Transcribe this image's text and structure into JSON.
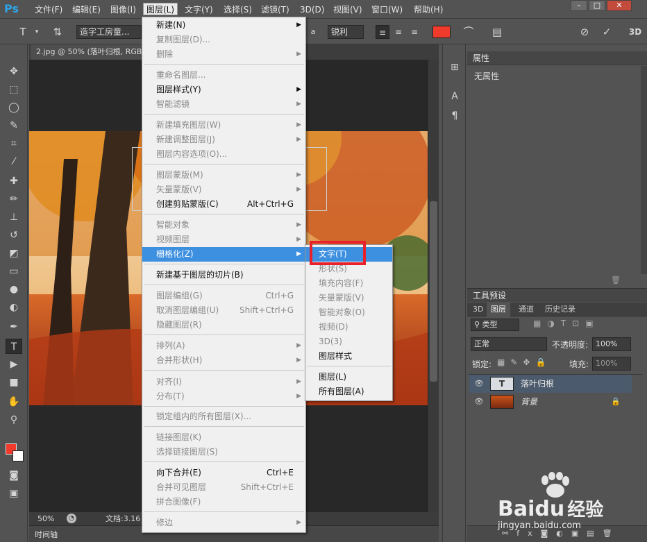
{
  "app": {
    "logo": "Ps",
    "menus": [
      "文件(F)",
      "编辑(E)",
      "图像(I)",
      "图层(L)",
      "文字(Y)",
      "选择(S)",
      "滤镜(T)",
      "3D(D)",
      "视图(V)",
      "窗口(W)",
      "帮助(H)"
    ],
    "active_menu_index": 3
  },
  "options_bar": {
    "font_name": "造字工房童...",
    "aa_label": "a",
    "antialias": "锐利",
    "text_color": "#f03a2c",
    "three_d": "3D"
  },
  "document": {
    "tab_title": "2.jpg @ 50% (落叶归根, RGB",
    "zoom": "50%",
    "doc_info": "文档:3.16"
  },
  "timeline": {
    "label": "时间轴"
  },
  "layer_menu": {
    "items": [
      {
        "label": "新建(N)",
        "shortcut": "",
        "submenu": true,
        "disabled": false
      },
      {
        "label": "复制图层(D)...",
        "shortcut": "",
        "submenu": false,
        "disabled": true
      },
      {
        "label": "删除",
        "shortcut": "",
        "submenu": true,
        "disabled": true
      },
      {
        "label": "重命名图层...",
        "shortcut": "",
        "submenu": false,
        "disabled": true
      },
      {
        "label": "图层样式(Y)",
        "shortcut": "",
        "submenu": true,
        "disabled": false
      },
      {
        "label": "智能滤镜",
        "shortcut": "",
        "submenu": true,
        "disabled": true
      },
      {
        "label": "新建填充图层(W)",
        "shortcut": "",
        "submenu": true,
        "disabled": true
      },
      {
        "label": "新建调整图层(J)",
        "shortcut": "",
        "submenu": true,
        "disabled": true
      },
      {
        "label": "图层内容选项(O)...",
        "shortcut": "",
        "submenu": false,
        "disabled": true
      },
      {
        "label": "图层蒙版(M)",
        "shortcut": "",
        "submenu": true,
        "disabled": true
      },
      {
        "label": "矢量蒙版(V)",
        "shortcut": "",
        "submenu": true,
        "disabled": true
      },
      {
        "label": "创建剪贴蒙版(C)",
        "shortcut": "Alt+Ctrl+G",
        "submenu": false,
        "disabled": false
      },
      {
        "label": "智能对象",
        "shortcut": "",
        "submenu": true,
        "disabled": true
      },
      {
        "label": "视频图层",
        "shortcut": "",
        "submenu": true,
        "disabled": true
      },
      {
        "label": "栅格化(Z)",
        "shortcut": "",
        "submenu": true,
        "disabled": false,
        "highlighted": true
      },
      {
        "label": "新建基于图层的切片(B)",
        "shortcut": "",
        "submenu": false,
        "disabled": false
      },
      {
        "label": "图层编组(G)",
        "shortcut": "Ctrl+G",
        "submenu": false,
        "disabled": true
      },
      {
        "label": "取消图层编组(U)",
        "shortcut": "Shift+Ctrl+G",
        "submenu": false,
        "disabled": true
      },
      {
        "label": "隐藏图层(R)",
        "shortcut": "",
        "submenu": false,
        "disabled": true
      },
      {
        "label": "排列(A)",
        "shortcut": "",
        "submenu": true,
        "disabled": true
      },
      {
        "label": "合并形状(H)",
        "shortcut": "",
        "submenu": true,
        "disabled": true
      },
      {
        "label": "对齐(I)",
        "shortcut": "",
        "submenu": true,
        "disabled": true
      },
      {
        "label": "分布(T)",
        "shortcut": "",
        "submenu": true,
        "disabled": true
      },
      {
        "label": "锁定组内的所有图层(X)...",
        "shortcut": "",
        "submenu": false,
        "disabled": true
      },
      {
        "label": "链接图层(K)",
        "shortcut": "",
        "submenu": false,
        "disabled": true
      },
      {
        "label": "选择链接图层(S)",
        "shortcut": "",
        "submenu": false,
        "disabled": true
      },
      {
        "label": "向下合并(E)",
        "shortcut": "Ctrl+E",
        "submenu": false,
        "disabled": false
      },
      {
        "label": "合并可见图层",
        "shortcut": "Shift+Ctrl+E",
        "submenu": false,
        "disabled": true
      },
      {
        "label": "拼合图像(F)",
        "shortcut": "",
        "submenu": false,
        "disabled": true
      },
      {
        "label": "修边",
        "shortcut": "",
        "submenu": true,
        "disabled": true
      }
    ]
  },
  "rasterize_submenu": {
    "items": [
      {
        "label": "文字(T)",
        "disabled": false,
        "highlighted": true
      },
      {
        "label": "形状(S)",
        "disabled": true
      },
      {
        "label": "填充内容(F)",
        "disabled": true
      },
      {
        "label": "矢量蒙版(V)",
        "disabled": true
      },
      {
        "label": "智能对象(O)",
        "disabled": true
      },
      {
        "label": "视频(D)",
        "disabled": true
      },
      {
        "label": "3D(3)",
        "disabled": true
      },
      {
        "label": "图层样式",
        "disabled": false
      },
      {
        "label": "图层(L)",
        "disabled": false
      },
      {
        "label": "所有图层(A)",
        "disabled": false
      }
    ]
  },
  "properties_panel": {
    "title": "属性",
    "empty_text": "无属性"
  },
  "tool_presets": {
    "title": "工具预设"
  },
  "layers_panel": {
    "tabs": [
      "3D",
      "图层",
      "通道",
      "历史记录"
    ],
    "active_tab_index": 1,
    "filter_kind": "类型",
    "blend_mode": "正常",
    "opacity_label": "不透明度:",
    "opacity_value": "100%",
    "lock_label": "锁定:",
    "fill_label": "填充:",
    "fill_value": "100%",
    "layers": [
      {
        "name": "落叶归根",
        "type": "text",
        "selected": true,
        "thumb_glyph": "T"
      },
      {
        "name": "背景",
        "type": "image",
        "selected": false,
        "locked": true
      }
    ]
  },
  "watermark": {
    "brand": "Bai",
    "brand_tail": "du",
    "service": "经验",
    "url": "jingyan.baidu.com"
  }
}
